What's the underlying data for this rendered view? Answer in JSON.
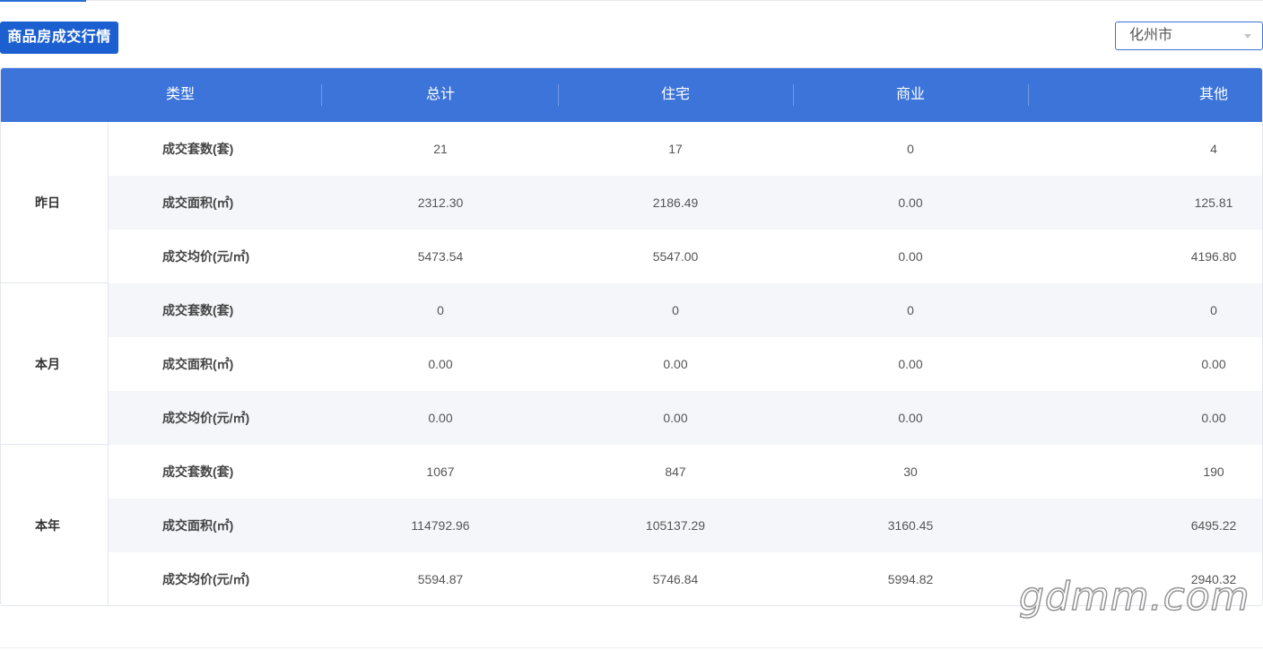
{
  "title_button": "商品房成交行情",
  "city_select": {
    "value": "化州市"
  },
  "table": {
    "headers": [
      "类型",
      "总计",
      "住宅",
      "商业",
      "其他"
    ],
    "groups": [
      {
        "label": "昨日",
        "rows": [
          {
            "label": "成交套数(套)",
            "values": [
              "21",
              "17",
              "0",
              "4"
            ]
          },
          {
            "label": "成交面积(㎡)",
            "values": [
              "2312.30",
              "2186.49",
              "0.00",
              "125.81"
            ]
          },
          {
            "label": "成交均价(元/㎡)",
            "values": [
              "5473.54",
              "5547.00",
              "0.00",
              "4196.80"
            ]
          }
        ]
      },
      {
        "label": "本月",
        "rows": [
          {
            "label": "成交套数(套)",
            "values": [
              "0",
              "0",
              "0",
              "0"
            ]
          },
          {
            "label": "成交面积(㎡)",
            "values": [
              "0.00",
              "0.00",
              "0.00",
              "0.00"
            ]
          },
          {
            "label": "成交均价(元/㎡)",
            "values": [
              "0.00",
              "0.00",
              "0.00",
              "0.00"
            ]
          }
        ]
      },
      {
        "label": "本年",
        "rows": [
          {
            "label": "成交套数(套)",
            "values": [
              "1067",
              "847",
              "30",
              "190"
            ]
          },
          {
            "label": "成交面积(㎡)",
            "values": [
              "114792.96",
              "105137.29",
              "3160.45",
              "6495.22"
            ]
          },
          {
            "label": "成交均价(元/㎡)",
            "values": [
              "5594.87",
              "5746.84",
              "5994.82",
              "2940.32"
            ]
          }
        ]
      }
    ]
  },
  "watermark": "gdmm.com",
  "colors": {
    "accent": "#1c5fd1",
    "header_bg": "#3c74da",
    "stripe": "#f4f6fa"
  }
}
